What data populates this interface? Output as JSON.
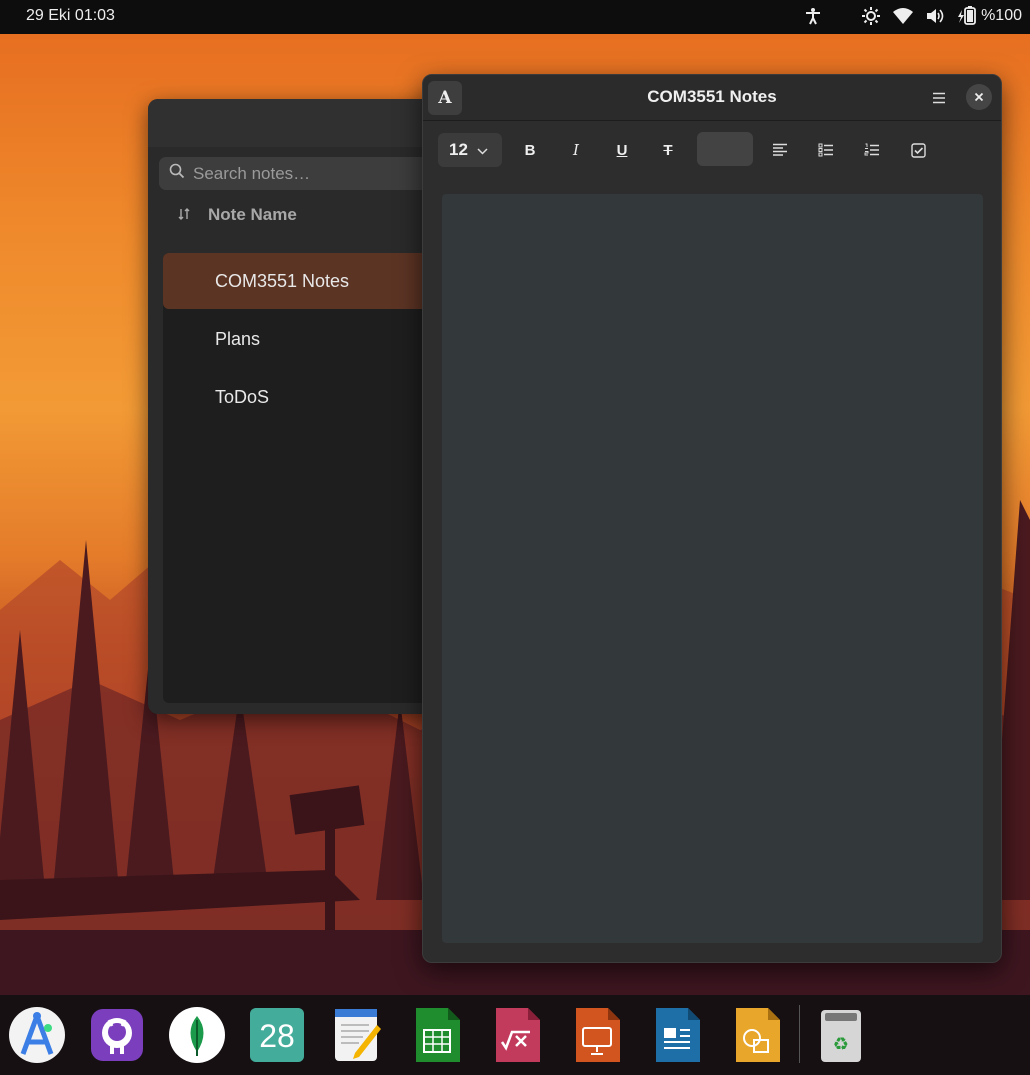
{
  "topbar": {
    "datetime": "29 Eki  01:03",
    "battery": "%100",
    "icons": [
      "accessibility-icon",
      "brightness-icon",
      "wifi-icon",
      "volume-icon",
      "battery-icon"
    ]
  },
  "list_window": {
    "search_placeholder": "Search notes…",
    "column_header": "Note Name",
    "notes": [
      {
        "name": "COM3551 Notes",
        "active": true
      },
      {
        "name": "Plans",
        "active": false
      },
      {
        "name": "ToDoS",
        "active": false
      }
    ]
  },
  "editor_window": {
    "title": "COM3551 Notes",
    "font_button": "A",
    "font_size": "12",
    "bold": "B",
    "italic": "I",
    "underline": "U",
    "strikethrough": "T",
    "content": ""
  },
  "dock": {
    "apps": [
      "android-studio-icon",
      "github-desktop-icon",
      "mongodb-compass-icon",
      "calendar-icon",
      "text-editor-icon",
      "libreoffice-calc-icon",
      "libreoffice-math-icon",
      "libreoffice-impress-icon",
      "libreoffice-writer-icon",
      "libreoffice-draw-icon",
      "trash-icon"
    ],
    "calendar_day": "28"
  },
  "colors": {
    "accent_active_row": "#5c3424",
    "window_bg": "#2d2d2d",
    "editor_bg": "#33383a"
  }
}
